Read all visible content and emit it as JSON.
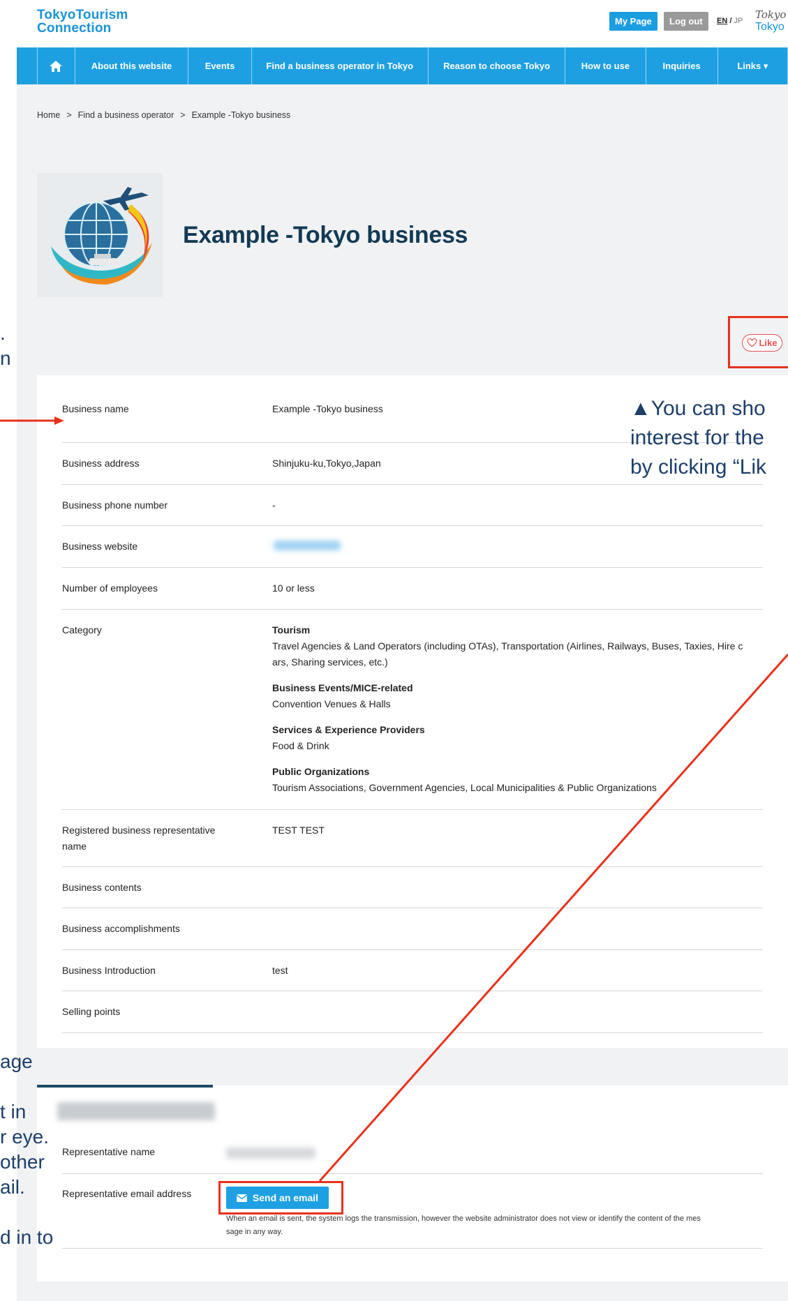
{
  "header": {
    "brand_line1": "TokyoTourism",
    "brand_line2": "Connection",
    "my_page_label": "My Page",
    "logout_label": "Log out",
    "lang_en": "EN",
    "lang_sep": "/",
    "lang_jp": "JP",
    "logo_line1": "Tokyo",
    "logo_line2": "Tokyo"
  },
  "nav": {
    "items": [
      {
        "label": "About this website"
      },
      {
        "label": "Events"
      },
      {
        "label": "Find a business operator in Tokyo"
      },
      {
        "label": "Reason to choose Tokyo"
      },
      {
        "label": "How to use"
      },
      {
        "label": "Inquiries"
      },
      {
        "label": "Links ▾"
      }
    ]
  },
  "breadcrumb": {
    "items": [
      "Home",
      "Find a business operator",
      "Example -Tokyo business"
    ],
    "separator": ">"
  },
  "profile": {
    "title": "Example -Tokyo business",
    "like_label": "Like"
  },
  "details": {
    "rows": [
      {
        "label": "Business name",
        "value": "Example -Tokyo business"
      },
      {
        "label": "Business address",
        "value": "Shinjuku-ku,Tokyo,Japan"
      },
      {
        "label": "Business phone number",
        "value": "-"
      },
      {
        "label": "Business website",
        "value": ""
      },
      {
        "label": "Number of employees",
        "value": "10 or less"
      },
      {
        "label": "Category",
        "value": ""
      },
      {
        "label": "Registered business representative name",
        "value": "TEST TEST"
      },
      {
        "label": "Business contents",
        "value": ""
      },
      {
        "label": "Business accomplishments",
        "value": ""
      },
      {
        "label": "Business Introduction",
        "value": "test"
      },
      {
        "label": "Selling points",
        "value": ""
      }
    ],
    "categories": [
      {
        "head": "Tourism",
        "body": "Travel Agencies & Land Operators (including OTAs), Transportation (Airlines, Railways, Buses, Taxies, Hire c",
        "body2": "ars, Sharing services, etc.)"
      },
      {
        "head": "Business Events/MICE-related",
        "body": "Convention Venues & Halls"
      },
      {
        "head": "Services & Experience Providers",
        "body": "Food & Drink"
      },
      {
        "head": "Public Organizations",
        "body": "Tourism Associations, Government Agencies, Local Municipalities & Public Organizations"
      }
    ]
  },
  "representative": {
    "name_label": "Representative name",
    "email_label": "Representative email address",
    "send_label": "Send an email",
    "note_line1": "When an email is sent, the system logs the transmission, however the website administrator does not view or identify the content of the mes",
    "note_line2": "sage in any way."
  },
  "annotations": {
    "right_line1": "▲You can sho",
    "right_line2": "interest for the",
    "right_line3": "by clicking “Lik",
    "left_top1": ".",
    "left_top2": "n",
    "left_bottom": [
      "age",
      "",
      "t in",
      "r eye.",
      "other",
      "ail.",
      "",
      "d in to"
    ]
  },
  "colors": {
    "accent": "#1e9fe2",
    "title": "#123a55",
    "annotation_red": "#e8311d",
    "annotation_text": "#1c3f6a"
  }
}
